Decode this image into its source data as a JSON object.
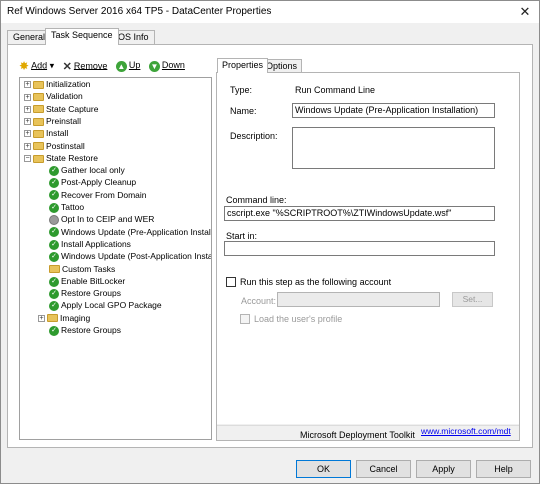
{
  "window": {
    "title": "Ref Windows Server 2016 x64 TP5 - DataCenter Properties",
    "close_glyph": "✕"
  },
  "tabs": [
    {
      "label": "General"
    },
    {
      "label": "Task Sequence"
    },
    {
      "label": "OS Info"
    }
  ],
  "toolbar": {
    "add_label": "Add",
    "add_dropdown": "▾",
    "remove_label": "Remove",
    "up_label": "Up",
    "down_label": "Down",
    "icons": {
      "add": "star-icon",
      "remove": "x-icon",
      "up": "up-arrow-icon",
      "down": "down-arrow-icon"
    }
  },
  "tree": {
    "items": [
      {
        "label": "Initialization",
        "icon": "folder-icon",
        "expander": "+"
      },
      {
        "label": "Validation",
        "icon": "folder-icon",
        "expander": "+"
      },
      {
        "label": "State Capture",
        "icon": "folder-icon",
        "expander": "+"
      },
      {
        "label": "Preinstall",
        "icon": "folder-icon",
        "expander": "+"
      },
      {
        "label": "Install",
        "icon": "folder-icon",
        "expander": "+"
      },
      {
        "label": "Postinstall",
        "icon": "folder-icon",
        "expander": "+"
      },
      {
        "label": "State Restore",
        "icon": "folder-icon",
        "expander": "−"
      },
      {
        "label": "Gather local only",
        "icon": "check-icon"
      },
      {
        "label": "Post-Apply Cleanup",
        "icon": "check-icon"
      },
      {
        "label": "Recover From Domain",
        "icon": "check-icon"
      },
      {
        "label": "Tattoo",
        "icon": "check-icon"
      },
      {
        "label": "Opt In to CEIP and WER",
        "icon": "gear-icon"
      },
      {
        "label": "Windows Update (Pre-Application Installa",
        "icon": "check-icon"
      },
      {
        "label": "Install Applications",
        "icon": "check-icon"
      },
      {
        "label": "Windows Update (Post-Application Install",
        "icon": "check-icon"
      },
      {
        "label": "Custom Tasks",
        "icon": "folder-icon"
      },
      {
        "label": "Enable BitLocker",
        "icon": "check-icon"
      },
      {
        "label": "Restore Groups",
        "icon": "check-icon"
      },
      {
        "label": "Apply Local GPO Package",
        "icon": "check-icon"
      },
      {
        "label": "Imaging",
        "icon": "folder-icon",
        "expander": "+"
      },
      {
        "label": "Restore Groups",
        "icon": "check-icon"
      }
    ]
  },
  "properties": {
    "tabs": [
      {
        "label": "Properties"
      },
      {
        "label": "Options"
      }
    ],
    "type_label": "Type:",
    "type_value": "Run Command Line",
    "name_label": "Name:",
    "name_value": "Windows Update (Pre-Application Installation)",
    "description_label": "Description:",
    "description_value": "",
    "command_line_label": "Command line:",
    "command_line_value": "cscript.exe \"%SCRIPTROOT%\\ZTIWindowsUpdate.wsf\"",
    "start_in_label": "Start in:",
    "start_in_value": "",
    "run_as_label": "Run this step as the following account",
    "account_label": "Account:",
    "account_value": "",
    "set_button": "Set...",
    "load_profile_label": "Load the user's profile",
    "footer_text": "Microsoft Deployment Toolkit",
    "footer_link": "www.microsoft.com/mdt"
  },
  "buttons": {
    "ok": "OK",
    "cancel": "Cancel",
    "apply": "Apply",
    "help": "Help"
  }
}
